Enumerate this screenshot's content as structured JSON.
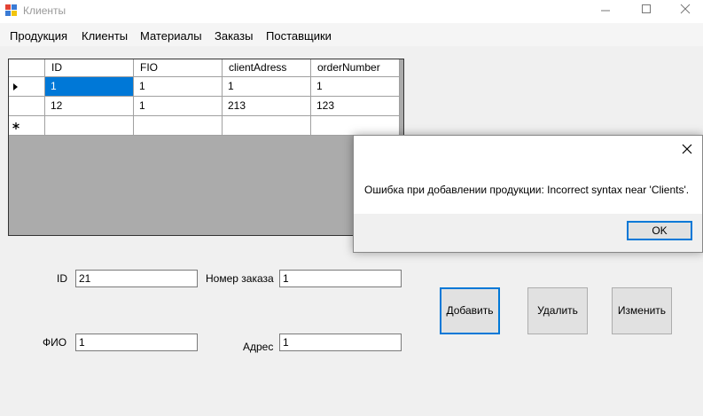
{
  "window": {
    "title": "Клиенты",
    "minimize_icon": "minimize-icon",
    "maximize_icon": "maximize-icon",
    "close_icon": "close-icon"
  },
  "menu": {
    "items": [
      "Продукция",
      "Клиенты",
      "Материалы",
      "Заказы",
      "Поставщики"
    ]
  },
  "grid": {
    "columns": [
      "ID",
      "FIO",
      "clientAdress",
      "orderNumber"
    ],
    "rows": [
      [
        "1",
        "1",
        "1",
        "1"
      ],
      [
        "12",
        "1",
        "213",
        "123"
      ]
    ],
    "current_row_icon": "triangle-right-icon",
    "new_row_icon": "asterisk-icon"
  },
  "form": {
    "id_label": "ID",
    "id_value": "21",
    "fio_label": "ФИО",
    "fio_value": "1",
    "order_label": "Номер заказа",
    "order_value": "1",
    "address_label": "Адрес",
    "address_value": "1"
  },
  "buttons": {
    "add": "Добавить",
    "delete": "Удалить",
    "edit": "Изменить"
  },
  "dialog": {
    "message": "Ошибка при добавлении продукции: Incorrect syntax near 'Clients'.",
    "ok": "OK"
  }
}
